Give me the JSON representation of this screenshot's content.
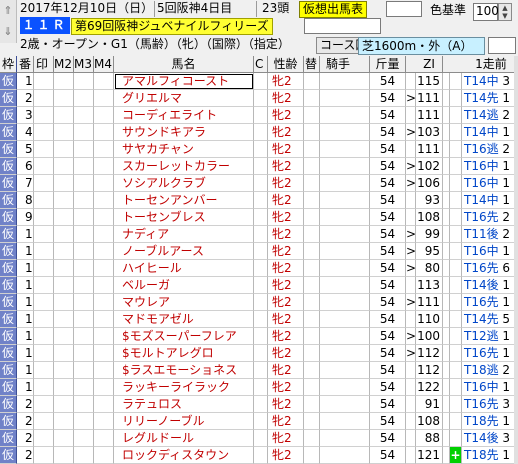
{
  "header": {
    "date": "2017年12月10日（日）",
    "meeting": "5回阪神4日目",
    "runners": "23頭",
    "mode_badge": "仮想出馬表",
    "color_label": "色基準",
    "color_value": "100",
    "race_no": "１１Ｒ",
    "race_name": "第69回阪神ジュベナイルフィリーズ",
    "conditions": "2歳・オープン・G1（馬齢）（牝）（国際）（指定）",
    "course_button": "コース図",
    "course_info": "芝1600m・外（A）"
  },
  "columns": {
    "waku": "枠",
    "ban": "番",
    "in": "印",
    "m2": "M2",
    "m3": "M3",
    "m4": "M4",
    "name": "馬名",
    "c": "C",
    "sex": "性齢",
    "kae": "替",
    "jockey": "騎手",
    "kin": "斤量",
    "zi": "ZI",
    "prev": "1走前"
  },
  "rows": [
    {
      "waku": "仮",
      "ban": "1",
      "name": "アマルフィコースト",
      "sex": "牝2",
      "kin": "54",
      "arr": "",
      "zi": "115",
      "plus": "",
      "prev": "T14中",
      "pn": "3"
    },
    {
      "waku": "仮",
      "ban": "2",
      "name": "グリエルマ",
      "sex": "牝2",
      "kin": "54",
      "arr": ">",
      "zi": "111",
      "plus": "",
      "prev": "T14先",
      "pn": "1"
    },
    {
      "waku": "仮",
      "ban": "3",
      "name": "コーディエライト",
      "sex": "牝2",
      "kin": "54",
      "arr": "",
      "zi": "111",
      "plus": "",
      "prev": "T14逃",
      "pn": "2"
    },
    {
      "waku": "仮",
      "ban": "4",
      "name": "サウンドキアラ",
      "sex": "牝2",
      "kin": "54",
      "arr": ">",
      "zi": "103",
      "plus": "",
      "prev": "T14中",
      "pn": "1"
    },
    {
      "waku": "仮",
      "ban": "5",
      "name": "サヤカチャン",
      "sex": "牝2",
      "kin": "54",
      "arr": "",
      "zi": "111",
      "plus": "",
      "prev": "T16逃",
      "pn": "2"
    },
    {
      "waku": "仮",
      "ban": "6",
      "name": "スカーレットカラー",
      "sex": "牝2",
      "kin": "54",
      "arr": ">",
      "zi": "102",
      "plus": "",
      "prev": "T16中",
      "pn": "1"
    },
    {
      "waku": "仮",
      "ban": "7",
      "name": "ソシアルクラブ",
      "sex": "牝2",
      "kin": "54",
      "arr": ">",
      "zi": "106",
      "plus": "",
      "prev": "T16中",
      "pn": "1"
    },
    {
      "waku": "仮",
      "ban": "8",
      "name": "トーセンアンバー",
      "sex": "牝2",
      "kin": "54",
      "arr": "",
      "zi": "93",
      "plus": "",
      "prev": "T14中",
      "pn": "1"
    },
    {
      "waku": "仮",
      "ban": "9",
      "name": "トーセンブレス",
      "sex": "牝2",
      "kin": "54",
      "arr": "",
      "zi": "108",
      "plus": "",
      "prev": "T16先",
      "pn": "2"
    },
    {
      "waku": "仮",
      "ban": "10",
      "name": "ナディア",
      "sex": "牝2",
      "kin": "54",
      "arr": ">",
      "zi": "99",
      "plus": "",
      "prev": "T11後",
      "pn": "2"
    },
    {
      "waku": "仮",
      "ban": "11",
      "name": "ノーブルアース",
      "sex": "牝2",
      "kin": "54",
      "arr": ">",
      "zi": "95",
      "plus": "",
      "prev": "T16中",
      "pn": "1"
    },
    {
      "waku": "仮",
      "ban": "12",
      "name": "ハイヒール",
      "sex": "牝2",
      "kin": "54",
      "arr": ">",
      "zi": "80",
      "plus": "",
      "prev": "T16先",
      "pn": "6"
    },
    {
      "waku": "仮",
      "ban": "13",
      "name": "ベルーガ",
      "sex": "牝2",
      "kin": "54",
      "arr": "",
      "zi": "113",
      "plus": "",
      "prev": "T14後",
      "pn": "1"
    },
    {
      "waku": "仮",
      "ban": "14",
      "name": "マウレア",
      "sex": "牝2",
      "kin": "54",
      "arr": ">",
      "zi": "111",
      "plus": "",
      "prev": "T16先",
      "pn": "1"
    },
    {
      "waku": "仮",
      "ban": "15",
      "name": "マドモアゼル",
      "sex": "牝2",
      "kin": "54",
      "arr": "",
      "zi": "110",
      "plus": "",
      "prev": "T14先",
      "pn": "5"
    },
    {
      "waku": "仮",
      "ban": "16",
      "name": "$モズスーパーフレア",
      "sex": "牝2",
      "kin": "54",
      "arr": ">",
      "zi": "100",
      "plus": "",
      "prev": "T12逃",
      "pn": "1"
    },
    {
      "waku": "仮",
      "ban": "17",
      "name": "$モルトアレグロ",
      "sex": "牝2",
      "kin": "54",
      "arr": ">",
      "zi": "112",
      "plus": "",
      "prev": "T16先",
      "pn": "1"
    },
    {
      "waku": "仮",
      "ban": "18",
      "name": "$ラスエモーショネス",
      "sex": "牝2",
      "kin": "54",
      "arr": "",
      "zi": "112",
      "plus": "",
      "prev": "T18逃",
      "pn": "2"
    },
    {
      "waku": "仮",
      "ban": "19",
      "name": "ラッキーライラック",
      "sex": "牝2",
      "kin": "54",
      "arr": "",
      "zi": "122",
      "plus": "",
      "prev": "T16中",
      "pn": "1"
    },
    {
      "waku": "仮",
      "ban": "20",
      "name": "ラテュロス",
      "sex": "牝2",
      "kin": "54",
      "arr": "",
      "zi": "91",
      "plus": "",
      "prev": "T16先",
      "pn": "3"
    },
    {
      "waku": "仮",
      "ban": "21",
      "name": "リリーノーブル",
      "sex": "牝2",
      "kin": "54",
      "arr": "",
      "zi": "108",
      "plus": "",
      "prev": "T18先",
      "pn": "1"
    },
    {
      "waku": "仮",
      "ban": "22",
      "name": "レグルドール",
      "sex": "牝2",
      "kin": "54",
      "arr": "",
      "zi": "88",
      "plus": "",
      "prev": "T14後",
      "pn": "3"
    },
    {
      "waku": "仮",
      "ban": "23",
      "name": "ロックディスタウン",
      "sex": "牝2",
      "kin": "54",
      "arr": "",
      "zi": "121",
      "plus": "+",
      "prev": "T18先",
      "pn": "1"
    }
  ]
}
